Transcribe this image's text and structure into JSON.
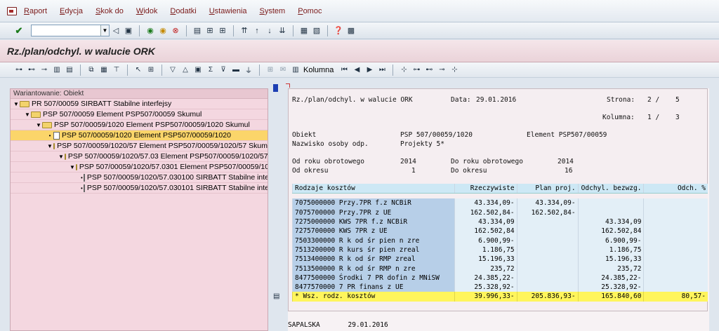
{
  "menu": [
    "Raport",
    "Edycja",
    "Skok do",
    "Widok",
    "Dodatki",
    "Ustawienia",
    "System",
    "Pomoc"
  ],
  "title": "Rz./plan/odchyl. w walucie ORK",
  "appbar": {
    "column_label": "Kolumna"
  },
  "tree": {
    "header": "Wariantowanie: Obiekt",
    "rows": [
      {
        "indent": 0,
        "expander": "▼",
        "icon": "folder",
        "label": "PR  507/00059 SIRBATT Stabilne interfejsy"
      },
      {
        "indent": 1,
        "expander": "▼",
        "icon": "folder",
        "label": "PSP 507/00059 Element PSP507/00059 Skumul"
      },
      {
        "indent": 2,
        "expander": "▼",
        "icon": "folder",
        "label": "PSP 507/00059/1020 Element PSP507/00059/1020 Skumul"
      },
      {
        "indent": 3,
        "expander": "•",
        "icon": "doc",
        "label": "PSP 507/00059/1020 Element PSP507/00059/1020",
        "selected": true
      },
      {
        "indent": 3,
        "expander": "▼",
        "icon": "folder",
        "label": "PSP 507/00059/1020/57 Element PSP507/00059/1020/57 Skum"
      },
      {
        "indent": 4,
        "expander": "▼",
        "icon": "folder",
        "label": "PSP 507/00059/1020/57.03 Element PSP507/00059/1020/57"
      },
      {
        "indent": 5,
        "expander": "▼",
        "icon": "folder",
        "label": "PSP 507/00059/1020/57.0301 Element PSP507/00059/10"
      },
      {
        "indent": 6,
        "expander": "•",
        "icon": "doc",
        "label": "PSP 507/00059/1020/57.030100 SIRBATT Stabilne inte"
      },
      {
        "indent": 6,
        "expander": "•",
        "icon": "doc",
        "label": "PSP 507/00059/1020/57.030101 SIRBATT Stabilne inte"
      }
    ]
  },
  "report": {
    "header": {
      "report_name": "Rz./plan/odchyl. w walucie ORK",
      "date_label": "Data:",
      "date": "29.01.2016",
      "page_label": "Strona:",
      "page": "2 /    5",
      "column_label": "Kolumna:",
      "column": "1 /    3"
    },
    "info": {
      "obiekt_label": "Obiekt",
      "obiekt_value": "PSP 507/00059/1020",
      "obiekt_extra": "Element PSP507/00059",
      "osoba_label": "Nazwisko osoby odp.",
      "osoba_value": "Projekty 5*",
      "od_roku_label": "Od roku obrotowego",
      "od_roku_value": "2014",
      "do_roku_label": "Do roku obrotowego",
      "do_roku_value": "2014",
      "od_okresu_label": "Od okresu",
      "od_okresu_value": "1",
      "do_okresu_label": "Do okresu",
      "do_okresu_value": "16"
    },
    "columns": [
      "Rodzaje kosztów",
      "Rzeczywiste",
      "Plan proj.",
      "Odchyl. bezwzg.",
      "Odch. %"
    ],
    "rows": [
      [
        "7075000000  Przy.7PR f.z NCBiR",
        "43.334,09-",
        "43.334,09-",
        "",
        ""
      ],
      [
        "7075700000  Przy.7PR z UE",
        "162.502,84-",
        "162.502,84-",
        "",
        ""
      ],
      [
        "7275000000  KWS 7PR f.z NCBiR",
        "43.334,09",
        "",
        "43.334,09",
        ""
      ],
      [
        "7275700000  KWS 7PR z UE",
        "162.502,84",
        "",
        "162.502,84",
        ""
      ],
      [
        "7503300000  R k od śr pien n zre",
        "6.900,99-",
        "",
        "6.900,99-",
        ""
      ],
      [
        "7513200000  R kurs śr pien zreal",
        "1.186,75",
        "",
        "1.186,75",
        ""
      ],
      [
        "7513400000  R k od śr RMP zreal",
        "15.196,33",
        "",
        "15.196,33",
        ""
      ],
      [
        "7513500000  R k od śr RMP n zre",
        "235,72",
        "",
        "235,72",
        ""
      ],
      [
        "8477500000  Środki 7 PR dofin z MNiSW",
        "24.385,22-",
        "",
        "24.385,22-",
        ""
      ],
      [
        "8477570000  7 PR finans z UE",
        "25.328,92-",
        "",
        "25.328,92-",
        ""
      ]
    ],
    "total": [
      "*   Wsz. rodz. kosztów",
      "39.996,33-",
      "205.836,93-",
      "165.840,60",
      "80,57-"
    ],
    "footer_user": "SAPALSKA",
    "footer_date": "29.01.2016"
  }
}
